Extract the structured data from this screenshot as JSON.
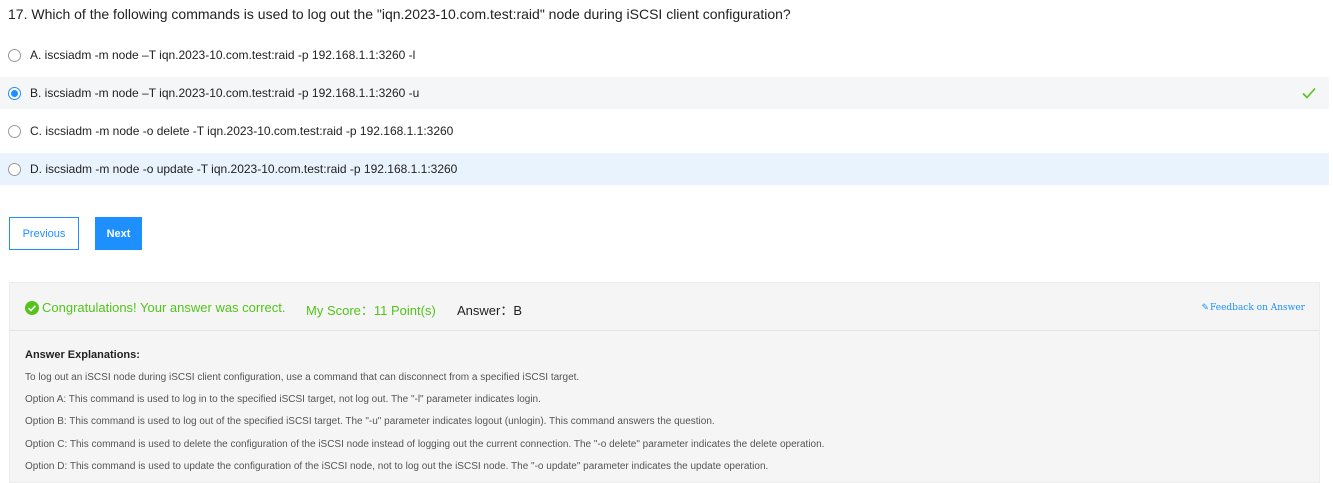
{
  "question": {
    "text": "17. Which of the following commands is used to log out the \"iqn.2023-10.com.test:raid\" node during iSCSI client configuration?"
  },
  "options": [
    {
      "text": "A. iscsiadm -m node –T iqn.2023-10.com.test:raid -p 192.168.1.1:3260 -l"
    },
    {
      "text": "B. iscsiadm -m node –T iqn.2023-10.com.test:raid -p 192.168.1.1:3260 -u"
    },
    {
      "text": "C. iscsiadm -m node -o delete -T iqn.2023-10.com.test:raid -p 192.168.1.1:3260"
    },
    {
      "text": "D. iscsiadm -m node -o update -T iqn.2023-10.com.test:raid -p 192.168.1.1:3260"
    }
  ],
  "nav": {
    "previous_label": "Previous",
    "next_label": "Next"
  },
  "result": {
    "congrats": "Congratulations! Your answer was correct.",
    "score": "My Score：11 Point(s)",
    "answer": "Answer：B",
    "feedback_label": "Feedback on Answer"
  },
  "explanation": {
    "title": "Answer Explanations:",
    "lines": [
      "To log out an iSCSI node during iSCSI client configuration, use a command that can disconnect from a specified iSCSI target.",
      "Option A: This command is used to log in to the specified iSCSI target, not log out. The \"-l\" parameter indicates login.",
      "Option B: This command is used to log out of the specified iSCSI target. The \"-u\" parameter indicates logout (unlogin). This command answers the question.",
      "Option C: This command is used to delete the configuration of the iSCSI node instead of logging out the current connection. The \"-o delete\" parameter indicates the delete operation.",
      "Option D: This command is used to update the configuration of the iSCSI node, not to log out the iSCSI node. The \"-o update\" parameter indicates the update operation."
    ]
  },
  "colors": {
    "accent": "#1e8fff",
    "success": "#52c41a"
  }
}
